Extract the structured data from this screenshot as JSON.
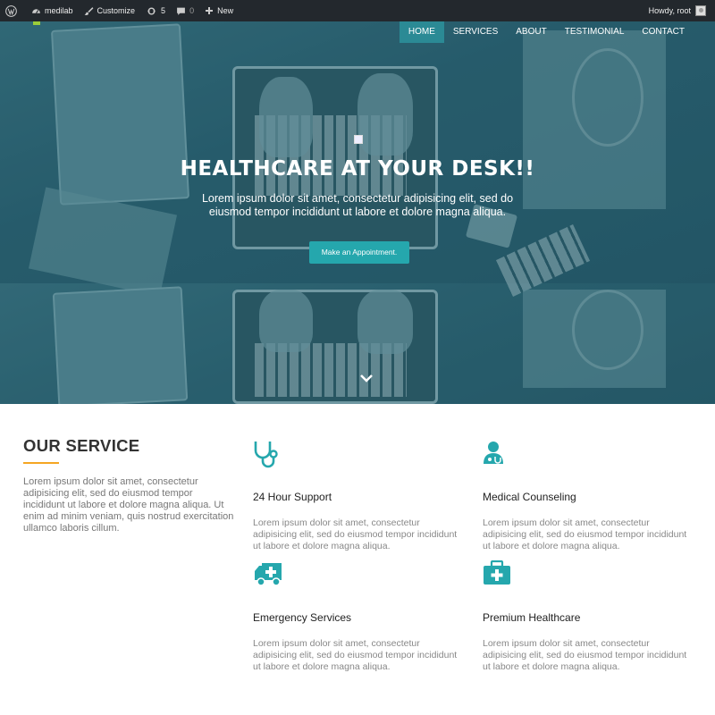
{
  "admin_bar": {
    "site_name": "medilab",
    "customize": "Customize",
    "updates_count": "5",
    "comments_count": "0",
    "new_label": "New",
    "howdy": "Howdy, root"
  },
  "nav": {
    "items": [
      {
        "label": "HOME",
        "active": true
      },
      {
        "label": "SERVICES",
        "active": false
      },
      {
        "label": "ABOUT",
        "active": false
      },
      {
        "label": "TESTIMONIAL",
        "active": false
      },
      {
        "label": "CONTACT",
        "active": false
      }
    ]
  },
  "hero": {
    "title": "HEALTHCARE AT YOUR DESK!!",
    "subtitle": "Lorem ipsum dolor sit amet, consectetur adipisicing elit, sed do eiusmod tempor incididunt ut labore et dolore magna aliqua.",
    "cta_label": "Make an Appointment."
  },
  "services": {
    "heading": "OUR SERVICE",
    "intro": "Lorem ipsum dolor sit amet, consectetur adipisicing elit, sed do eiusmod tempor incididunt ut labore et dolore magna aliqua. Ut enim ad minim veniam, quis nostrud exercitation ullamco laboris cillum.",
    "items": [
      {
        "icon": "stethoscope-icon",
        "title": "24 Hour Support",
        "text": "Lorem ipsum dolor sit amet, consectetur adipisicing elit, sed do eiusmod tempor incididunt ut labore et dolore magna aliqua."
      },
      {
        "icon": "doctor-icon",
        "title": "Medical Counseling",
        "text": "Lorem ipsum dolor sit amet, consectetur adipisicing elit, sed do eiusmod tempor incididunt ut labore et dolore magna aliqua."
      },
      {
        "icon": "ambulance-icon",
        "title": "Emergency Services",
        "text": "Lorem ipsum dolor sit amet, consectetur adipisicing elit, sed do eiusmod tempor incididunt ut labore et dolore magna aliqua."
      },
      {
        "icon": "medical-kit-icon",
        "title": "Premium Healthcare",
        "text": "Lorem ipsum dolor sit amet, consectetur adipisicing elit, sed do eiusmod tempor incididunt ut labore et dolore magna aliqua."
      }
    ]
  },
  "colors": {
    "accent": "#25a7ad",
    "underline": "#f5a623",
    "hero_tint": "#2b5d6c",
    "admin_bar": "#23282d"
  }
}
